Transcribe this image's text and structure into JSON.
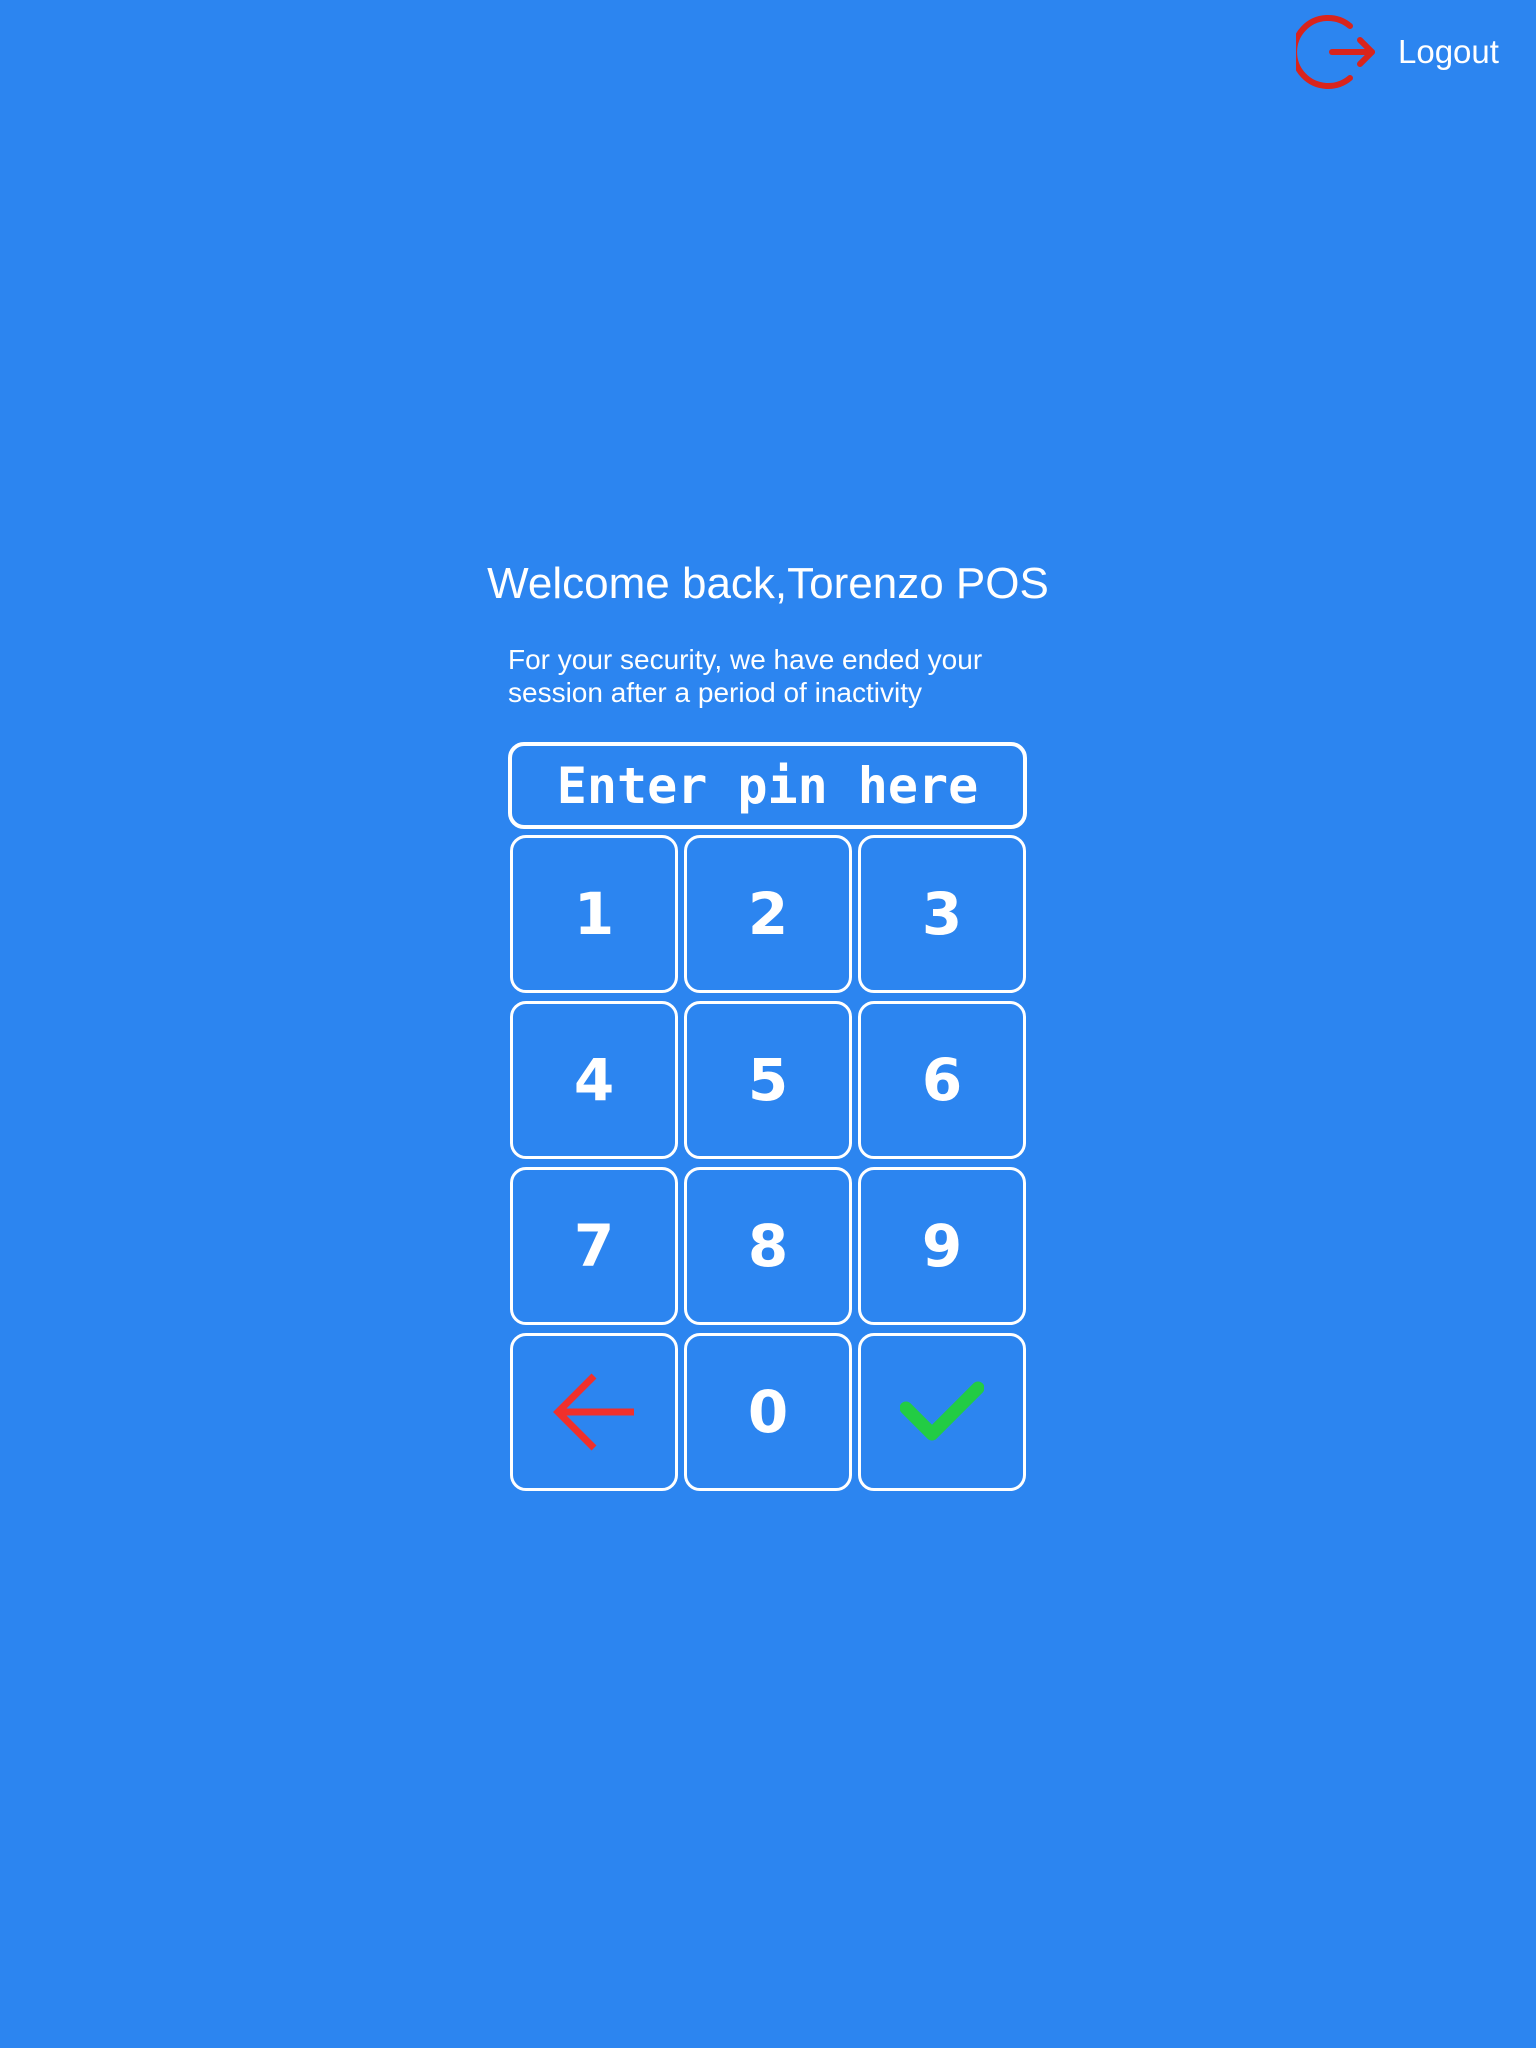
{
  "header": {
    "logout_label": "Logout",
    "logout_icon": "logout-icon"
  },
  "main": {
    "welcome": "Welcome back,Torenzo POS",
    "security_message_line1": "For your security, we have ended your",
    "security_message_line2": "session after a period of inactivity",
    "pin_placeholder": "Enter pin here",
    "pin_value": ""
  },
  "keypad": {
    "keys": [
      "1",
      "2",
      "3",
      "4",
      "5",
      "6",
      "7",
      "8",
      "9",
      "0"
    ],
    "backspace_icon": "arrow-left-icon",
    "submit_icon": "checkmark-icon"
  },
  "colors": {
    "background": "#2c85f0",
    "logout_icon": "#d9241c",
    "backspace_icon": "#f0302b",
    "submit_icon": "#22cc44",
    "text": "#ffffff"
  }
}
